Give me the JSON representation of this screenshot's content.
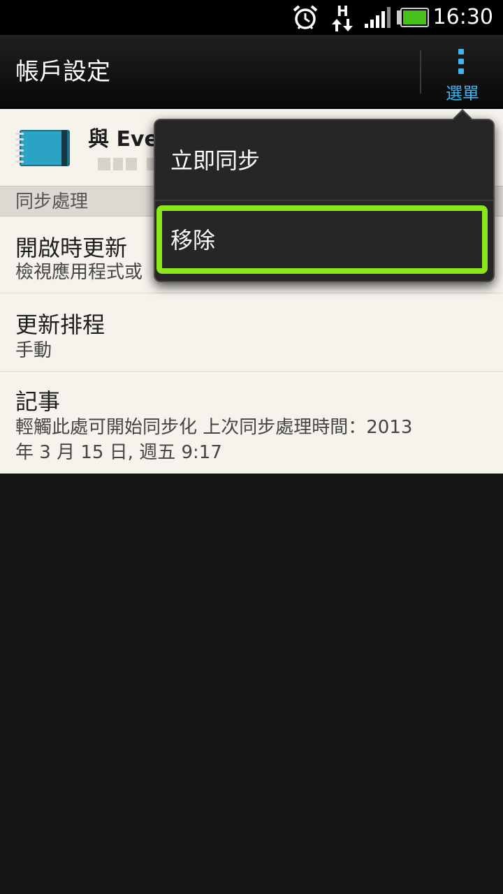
{
  "status_bar": {
    "time": "16:30",
    "network_letter": "H",
    "icons": [
      "alarm-clock-icon",
      "data-transfer-icon",
      "signal-strength-icon",
      "battery-icon"
    ]
  },
  "action_bar": {
    "title": "帳戶設定",
    "menu_label": "選單",
    "menu_icon": "overflow-menu-icon",
    "accent_color": "#3eb5f1"
  },
  "account": {
    "icon": "evernote-notebook-icon",
    "name": "與 Eve"
  },
  "section_header": "同步處理",
  "items": [
    {
      "title": "開啟時更新",
      "subtitle": "檢視應用程式或"
    },
    {
      "title": "更新排程",
      "subtitle": "手動"
    },
    {
      "title": "記事",
      "subtitle_line1": "輕觸此處可開始同步化  上次同步處理時間：2013",
      "subtitle_line2": "年 3 月 15 日, 週五 9:17"
    }
  ],
  "popup_menu": {
    "items": [
      "立即同步",
      "移除"
    ],
    "highlighted_item": "移除",
    "highlight_color": "#8be61c"
  }
}
